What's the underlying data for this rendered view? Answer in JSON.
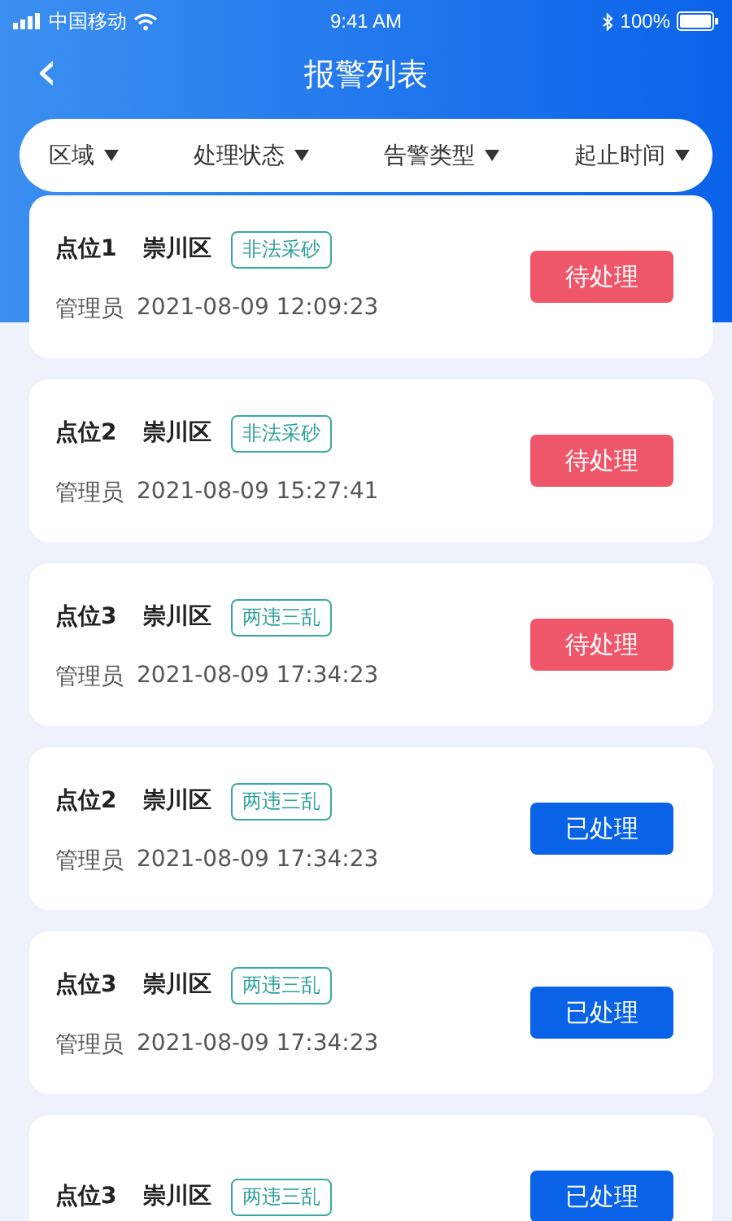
{
  "status_bar": {
    "carrier": "中国移动",
    "time": "9:41 AM",
    "battery": "100%"
  },
  "header": {
    "back": "‹",
    "title": "报警列表"
  },
  "filters": [
    {
      "label": "区域"
    },
    {
      "label": "处理状态"
    },
    {
      "label": "告警类型"
    },
    {
      "label": "起止时间"
    }
  ],
  "alerts": [
    {
      "point": "点位1",
      "district": "崇川区",
      "tag": "非法采砂",
      "role": "管理员",
      "time": "2021-08-09 12:09:23",
      "status": {
        "kind": "pending",
        "label": "待处理"
      }
    },
    {
      "point": "点位2",
      "district": "崇川区",
      "tag": "非法采砂",
      "role": "管理员",
      "time": "2021-08-09 15:27:41",
      "status": {
        "kind": "pending",
        "label": "待处理"
      }
    },
    {
      "point": "点位3",
      "district": "崇川区",
      "tag": "两违三乱",
      "role": "管理员",
      "time": "2021-08-09 17:34:23",
      "status": {
        "kind": "pending",
        "label": "待处理"
      }
    },
    {
      "point": "点位2",
      "district": "崇川区",
      "tag": "两违三乱",
      "role": "管理员",
      "time": "2021-08-09 17:34:23",
      "status": {
        "kind": "done",
        "label": "已处理"
      }
    },
    {
      "point": "点位3",
      "district": "崇川区",
      "tag": "两违三乱",
      "role": "管理员",
      "time": "2021-08-09 17:34:23",
      "status": {
        "kind": "done",
        "label": "已处理"
      }
    },
    {
      "point": "点位3",
      "district": "崇川区",
      "tag": "两违三乱",
      "status": {
        "kind": "done",
        "label": "已处理"
      }
    }
  ]
}
